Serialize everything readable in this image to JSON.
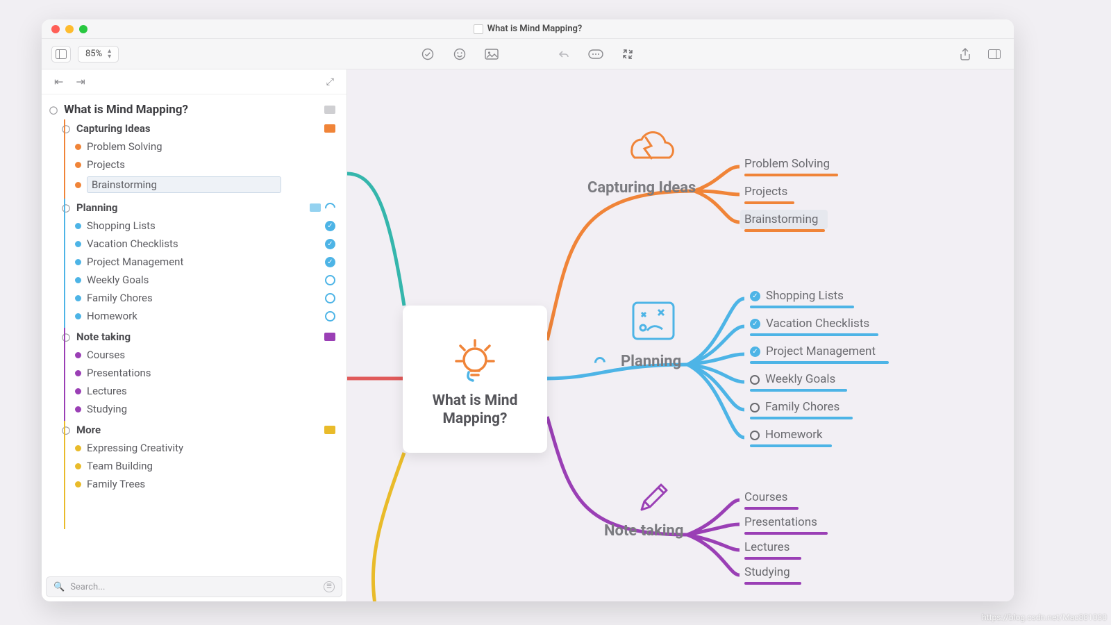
{
  "window": {
    "title": "What is Mind Mapping?"
  },
  "toolbar": {
    "zoom": "85%"
  },
  "search": {
    "placeholder": "Search..."
  },
  "watermark": "https://blog.csdn.net/Mac881030",
  "colors": {
    "orange": "#f08438",
    "blue": "#4db4e6",
    "purple": "#9a3fb5",
    "yellow": "#e9bb2a",
    "teal": "#35b6ac",
    "red": "#e05a5a"
  },
  "central": {
    "title_line1": "What is Mind",
    "title_line2": "Mapping?"
  },
  "outline": {
    "root": "What is Mind Mapping?",
    "groups": [
      {
        "label": "Capturing Ideas",
        "color": "orange",
        "has_image_badge": true,
        "items": [
          {
            "label": "Problem Solving"
          },
          {
            "label": "Projects"
          },
          {
            "label": "Brainstorming",
            "editing": true
          }
        ]
      },
      {
        "label": "Planning",
        "color": "blue",
        "has_image_badge": true,
        "has_progress": true,
        "items": [
          {
            "label": "Shopping Lists",
            "checked": true
          },
          {
            "label": "Vacation Checklists",
            "checked": true
          },
          {
            "label": "Project Management",
            "checked": true
          },
          {
            "label": "Weekly Goals",
            "checked": false
          },
          {
            "label": "Family Chores",
            "checked": false
          },
          {
            "label": "Homework",
            "checked": false
          }
        ]
      },
      {
        "label": "Note taking",
        "color": "purple",
        "has_image_badge": true,
        "items": [
          {
            "label": "Courses"
          },
          {
            "label": "Presentations"
          },
          {
            "label": "Lectures"
          },
          {
            "label": "Studying"
          }
        ]
      },
      {
        "label": "More",
        "color": "yellow",
        "has_image_badge": true,
        "items": [
          {
            "label": "Expressing Creativity"
          },
          {
            "label": "Team Building"
          },
          {
            "label": "Family Trees"
          }
        ]
      }
    ]
  },
  "canvas": {
    "branches": [
      {
        "label": "Capturing Ideas",
        "color": "orange"
      },
      {
        "label": "Planning",
        "color": "blue"
      },
      {
        "label": "Note taking",
        "color": "purple"
      }
    ],
    "leaves": {
      "capturing": [
        {
          "label": "Problem Solving"
        },
        {
          "label": "Projects"
        },
        {
          "label": "Brainstorming",
          "selected": true
        }
      ],
      "planning": [
        {
          "label": "Shopping Lists",
          "checked": true
        },
        {
          "label": "Vacation Checklists",
          "checked": true
        },
        {
          "label": "Project Management",
          "checked": true
        },
        {
          "label": "Weekly Goals",
          "checked": false
        },
        {
          "label": "Family Chores",
          "checked": false
        },
        {
          "label": "Homework",
          "checked": false
        }
      ],
      "notetaking": [
        {
          "label": "Courses"
        },
        {
          "label": "Presentations"
        },
        {
          "label": "Lectures"
        },
        {
          "label": "Studying"
        }
      ]
    }
  }
}
